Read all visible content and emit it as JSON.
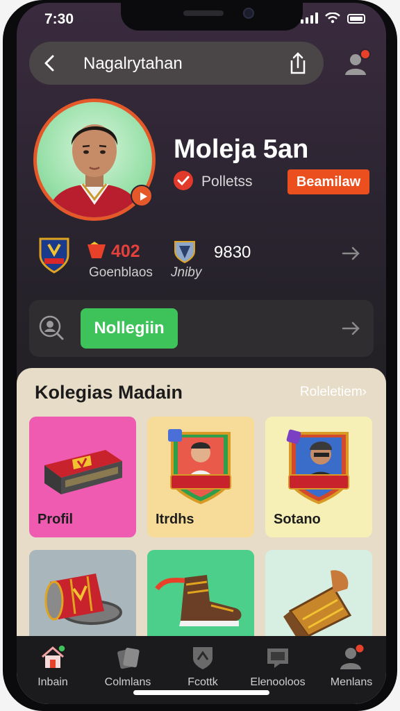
{
  "status_bar": {
    "time": "7:30"
  },
  "header": {
    "title": "Nagalrytahan"
  },
  "profile": {
    "name": "Moleja 5an",
    "subtitle": "Polletss",
    "follow_label": "Beamilaw"
  },
  "stats": [
    {
      "value": "402",
      "label": "Goenblaos"
    },
    {
      "value": "9830",
      "label": "Jniby"
    }
  ],
  "search": {
    "button_label": "Nollegiin"
  },
  "collection": {
    "title": "Kolegias Madain",
    "link": "Roleletiem",
    "items": [
      {
        "label": "Profil",
        "bg": "#ee5bb1"
      },
      {
        "label": "Itrdhs",
        "bg": "#f6dc98"
      },
      {
        "label": "Sotano",
        "bg": "#f7f0b6"
      },
      {
        "label": "",
        "bg": "#a9b7bd"
      },
      {
        "label": "",
        "bg": "#4bcf8a"
      },
      {
        "label": "",
        "bg": "#d6efe2"
      }
    ]
  },
  "nav": [
    {
      "label": "Inbain",
      "icon": "home-icon"
    },
    {
      "label": "Colmlans",
      "icon": "cards-icon"
    },
    {
      "label": "Fcottk",
      "icon": "shield-icon"
    },
    {
      "label": "Elenooloos",
      "icon": "chat-icon"
    },
    {
      "label": "Menlans",
      "icon": "person-icon"
    }
  ],
  "colors": {
    "accent": "#ec4f1e",
    "green": "#3ec35b",
    "panel": "#e7dcc7"
  }
}
